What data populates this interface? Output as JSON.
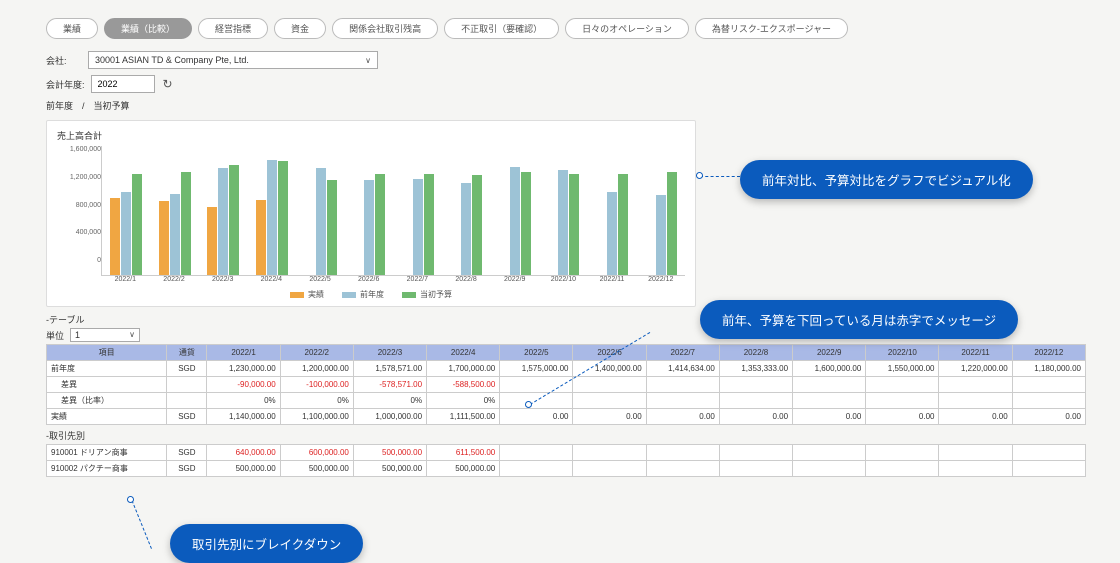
{
  "tabs": [
    "業績",
    "業績（比較）",
    "経営指標",
    "資金",
    "関係会社取引残高",
    "不正取引（要確認）",
    "日々のオペレーション",
    "為替リスク-エクスポージャー"
  ],
  "active_tab": 1,
  "filters": {
    "company_label": "会社:",
    "company_value": "30001 ASIAN TD & Company Pte, Ltd.",
    "year_label": "会計年度:",
    "year_value": "2022",
    "subline": "前年度　/　当初予算"
  },
  "chart": {
    "title": "売上高合計",
    "yticks": [
      "1,600,000",
      "1,200,000",
      "800,000",
      "400,000",
      "0"
    ],
    "months": [
      "2022/1",
      "2022/2",
      "2022/3",
      "2022/4",
      "2022/5",
      "2022/6",
      "2022/7",
      "2022/8",
      "2022/9",
      "2022/10",
      "2022/11",
      "2022/12"
    ],
    "legend": {
      "a": "実績",
      "b": "前年度",
      "c": "当初予算"
    }
  },
  "chart_data": {
    "type": "bar",
    "categories": [
      "2022/1",
      "2022/2",
      "2022/3",
      "2022/4",
      "2022/5",
      "2022/6",
      "2022/7",
      "2022/8",
      "2022/9",
      "2022/10",
      "2022/11",
      "2022/12"
    ],
    "series": [
      {
        "name": "実績",
        "values": [
          1140000,
          1100000,
          1000000,
          1111500,
          0,
          0,
          0,
          0,
          0,
          0,
          0,
          0
        ]
      },
      {
        "name": "前年度",
        "values": [
          1230000,
          1200000,
          1578571,
          1700000,
          1575000,
          1400000,
          1414634,
          1353333,
          1600000,
          1550000,
          1220000,
          1180000
        ]
      },
      {
        "name": "当初予算",
        "values": [
          1500000,
          1520000,
          1620000,
          1680000,
          1400000,
          1500000,
          1500000,
          1480000,
          1520000,
          1500000,
          1500000,
          1520000
        ]
      }
    ],
    "ylabel": "",
    "xlabel": "",
    "ylim": [
      0,
      1700000
    ],
    "title": "売上高合計"
  },
  "table_section": {
    "heading": "-テーブル",
    "unit_label": "単位",
    "unit_value": "1"
  },
  "partner_section": {
    "heading": "-取引先別"
  },
  "columns": [
    "項目",
    "通貨",
    "2022/1",
    "2022/2",
    "2022/3",
    "2022/4",
    "2022/5",
    "2022/6",
    "2022/7",
    "2022/8",
    "2022/9",
    "2022/10",
    "2022/11",
    "2022/12"
  ],
  "rows_main": [
    {
      "label": "前年度",
      "ccy": "SGD",
      "vals": [
        "1,230,000.00",
        "1,200,000.00",
        "1,578,571.00",
        "1,700,000.00",
        "1,575,000.00",
        "1,400,000.00",
        "1,414,634.00",
        "1,353,333.00",
        "1,600,000.00",
        "1,550,000.00",
        "1,220,000.00",
        "1,180,000.00"
      ],
      "indent": false
    },
    {
      "label": "差異",
      "ccy": "",
      "vals": [
        "-90,000.00",
        "-100,000.00",
        "-578,571.00",
        "-588,500.00",
        "",
        "",
        "",
        "",
        "",
        "",
        "",
        ""
      ],
      "neg": [
        true,
        true,
        true,
        true,
        false,
        false,
        false,
        false,
        false,
        false,
        false,
        false
      ],
      "indent": true
    },
    {
      "label": "差異（比率）",
      "ccy": "",
      "vals": [
        "0%",
        "0%",
        "0%",
        "0%",
        "",
        "",
        "",
        "",
        "",
        "",
        "",
        ""
      ],
      "indent": true
    },
    {
      "label": "実績",
      "ccy": "SGD",
      "vals": [
        "1,140,000.00",
        "1,100,000.00",
        "1,000,000.00",
        "1,111,500.00",
        "0.00",
        "0.00",
        "0.00",
        "0.00",
        "0.00",
        "0.00",
        "0.00",
        "0.00"
      ],
      "indent": false
    }
  ],
  "rows_partner": [
    {
      "label": "910001 ドリアン商事",
      "ccy": "SGD",
      "vals": [
        "640,000.00",
        "600,000.00",
        "500,000.00",
        "611,500.00",
        "",
        "",
        "",
        "",
        "",
        "",
        "",
        ""
      ],
      "neg": [
        true,
        true,
        true,
        true,
        false,
        false,
        false,
        false,
        false,
        false,
        false,
        false
      ]
    },
    {
      "label": "910002 パクチー商事",
      "ccy": "SGD",
      "vals": [
        "500,000.00",
        "500,000.00",
        "500,000.00",
        "500,000.00",
        "",
        "",
        "",
        "",
        "",
        "",
        "",
        ""
      ]
    }
  ],
  "callouts": {
    "c1": "前年対比、予算対比をグラフでビジュアル化",
    "c2": "前年、予算を下回っている月は赤字でメッセージ",
    "c3": "取引先別にブレイクダウン"
  }
}
